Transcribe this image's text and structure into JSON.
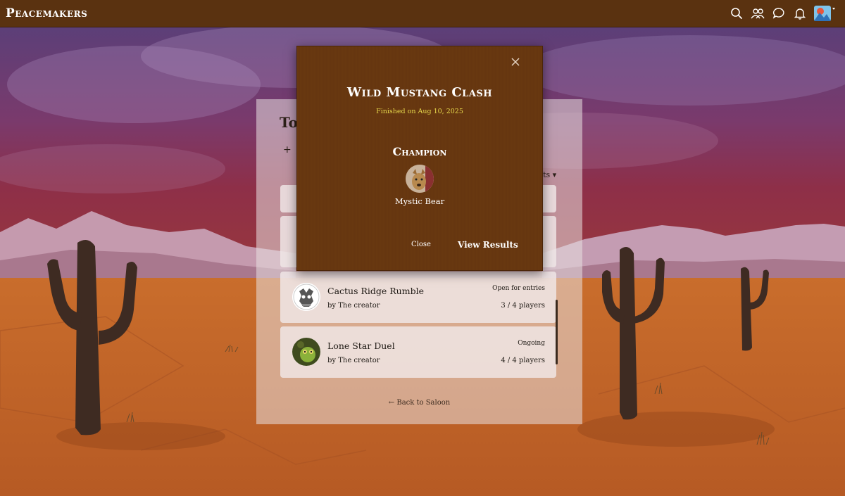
{
  "app": {
    "brand": "Peacemakers"
  },
  "header": {
    "icons": [
      "search-icon",
      "friends-icon",
      "chat-icon",
      "bell-icon",
      "profile-avatar"
    ]
  },
  "panel": {
    "title": "To",
    "new_label": "+",
    "filter_label": "nts ▾",
    "tournaments": [
      {
        "name": "Cactus Ridge Rumble",
        "by": "by The creator",
        "status": "Open for entries",
        "players": "3 / 4 players"
      },
      {
        "name": "Lone Star Duel",
        "by": "by The creator",
        "status": "Ongoing",
        "players": "4 / 4 players"
      }
    ],
    "back_link": "← Back to Saloon"
  },
  "modal": {
    "title": "Wild Mustang Clash",
    "finished": "Finished on Aug 10, 2025",
    "champion_heading": "Champion",
    "champion_name": "Mystic Bear",
    "close_button": "Close",
    "view_results_button": "View Results"
  },
  "colors": {
    "topbar": "#5a3210",
    "modal_bg": "#66360f",
    "accent_yellow": "#e6d84c"
  }
}
